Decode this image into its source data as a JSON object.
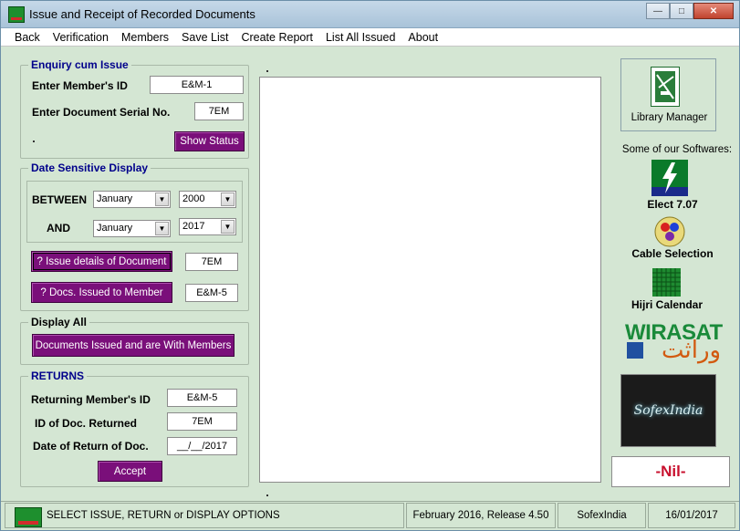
{
  "window": {
    "title": "Issue and Receipt of Recorded Documents",
    "minimize_label": "—",
    "maximize_label": "□",
    "close_label": "✕"
  },
  "menu": [
    "Back",
    "Verification",
    "Members",
    "Save List",
    "Create Report",
    "List All Issued",
    "About"
  ],
  "enquiry": {
    "title": "Enquiry cum Issue",
    "member_id_label": "Enter Member's ID",
    "member_id_value": "E&M-1",
    "doc_serial_label": "Enter Document Serial No.",
    "doc_serial_value": "7EM",
    "show_status_button": "Show Status"
  },
  "date_display": {
    "title": "Date Sensitive Display",
    "between_label": "BETWEEN",
    "and_label": "AND",
    "from_month": "January",
    "from_year": "2000",
    "to_month": "January",
    "to_year": "2017",
    "issue_details_button": "? Issue details of Document",
    "issue_details_value": "7EM",
    "docs_issued_button": "? Docs. Issued to Member",
    "docs_issued_value": "E&M-5"
  },
  "display_all": {
    "title": "Display All",
    "button": "Documents Issued and are With Members"
  },
  "returns": {
    "title": "RETURNS",
    "member_label": "Returning Member's ID",
    "member_value": "E&M-5",
    "doc_label": "ID of Doc. Returned",
    "doc_value": "7EM",
    "date_label": "Date of Return of Doc.",
    "date_value": "__/__/2017",
    "accept_button": "Accept"
  },
  "right_panel": {
    "library_label": "Library Manager",
    "softwares_title": "Some of our Softwares:",
    "software": [
      "Elect 7.07",
      "Cable Selection",
      "Hijri Calendar"
    ],
    "wirasat_logo": "WIRASAT",
    "wirasat_urdu": "وراثت",
    "sofex_logo": "SofexIndia",
    "nil_text": "-Nil-"
  },
  "status": {
    "message": "SELECT ISSUE, RETURN or DISPLAY OPTIONS",
    "release": "February 2016, Release 4.50",
    "company": "SofexIndia",
    "date": "16/01/2017"
  },
  "colors": {
    "background": "#d4e6d3",
    "button": "#7a0f7a",
    "group_title": "#00008b",
    "nil": "#c8102e"
  }
}
